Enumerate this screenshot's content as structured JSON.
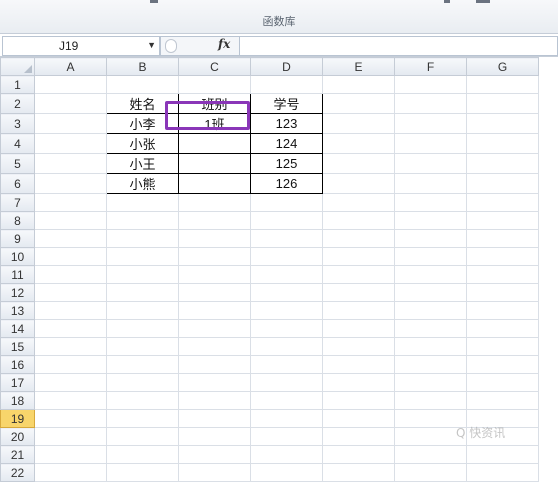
{
  "ribbon": {
    "group_label": "函数库"
  },
  "formula_bar": {
    "name_box": "J19",
    "fx_label": "fx",
    "formula": ""
  },
  "columns": [
    "A",
    "B",
    "C",
    "D",
    "E",
    "F",
    "G"
  ],
  "rows": [
    {
      "num": "1",
      "cells": [
        "",
        "",
        "",
        "",
        "",
        "",
        ""
      ]
    },
    {
      "num": "2",
      "cells": [
        "",
        "姓名",
        "班别",
        "学号",
        "",
        "",
        ""
      ]
    },
    {
      "num": "3",
      "cells": [
        "",
        "小李",
        "1班",
        "123",
        "",
        "",
        ""
      ]
    },
    {
      "num": "4",
      "cells": [
        "",
        "小张",
        "",
        "124",
        "",
        "",
        ""
      ]
    },
    {
      "num": "5",
      "cells": [
        "",
        "小王",
        "",
        "125",
        "",
        "",
        ""
      ]
    },
    {
      "num": "6",
      "cells": [
        "",
        "小熊",
        "",
        "126",
        "",
        "",
        ""
      ]
    },
    {
      "num": "7",
      "cells": [
        "",
        "",
        "",
        "",
        "",
        "",
        ""
      ]
    },
    {
      "num": "8",
      "cells": [
        "",
        "",
        "",
        "",
        "",
        "",
        ""
      ]
    },
    {
      "num": "9",
      "cells": [
        "",
        "",
        "",
        "",
        "",
        "",
        ""
      ]
    },
    {
      "num": "10",
      "cells": [
        "",
        "",
        "",
        "",
        "",
        "",
        ""
      ]
    },
    {
      "num": "11",
      "cells": [
        "",
        "",
        "",
        "",
        "",
        "",
        ""
      ]
    },
    {
      "num": "12",
      "cells": [
        "",
        "",
        "",
        "",
        "",
        "",
        ""
      ]
    },
    {
      "num": "13",
      "cells": [
        "",
        "",
        "",
        "",
        "",
        "",
        ""
      ]
    },
    {
      "num": "14",
      "cells": [
        "",
        "",
        "",
        "",
        "",
        "",
        ""
      ]
    },
    {
      "num": "15",
      "cells": [
        "",
        "",
        "",
        "",
        "",
        "",
        ""
      ]
    },
    {
      "num": "16",
      "cells": [
        "",
        "",
        "",
        "",
        "",
        "",
        ""
      ]
    },
    {
      "num": "17",
      "cells": [
        "",
        "",
        "",
        "",
        "",
        "",
        ""
      ]
    },
    {
      "num": "18",
      "cells": [
        "",
        "",
        "",
        "",
        "",
        "",
        ""
      ]
    },
    {
      "num": "19",
      "cells": [
        "",
        "",
        "",
        "",
        "",
        "",
        ""
      ]
    },
    {
      "num": "20",
      "cells": [
        "",
        "",
        "",
        "",
        "",
        "",
        ""
      ]
    },
    {
      "num": "21",
      "cells": [
        "",
        "",
        "",
        "",
        "",
        "",
        ""
      ]
    },
    {
      "num": "22",
      "cells": [
        "",
        "",
        "",
        "",
        "",
        "",
        ""
      ]
    }
  ],
  "active_row": "19",
  "highlight_color": "#8a36b8",
  "watermark": "Q 快资讯"
}
